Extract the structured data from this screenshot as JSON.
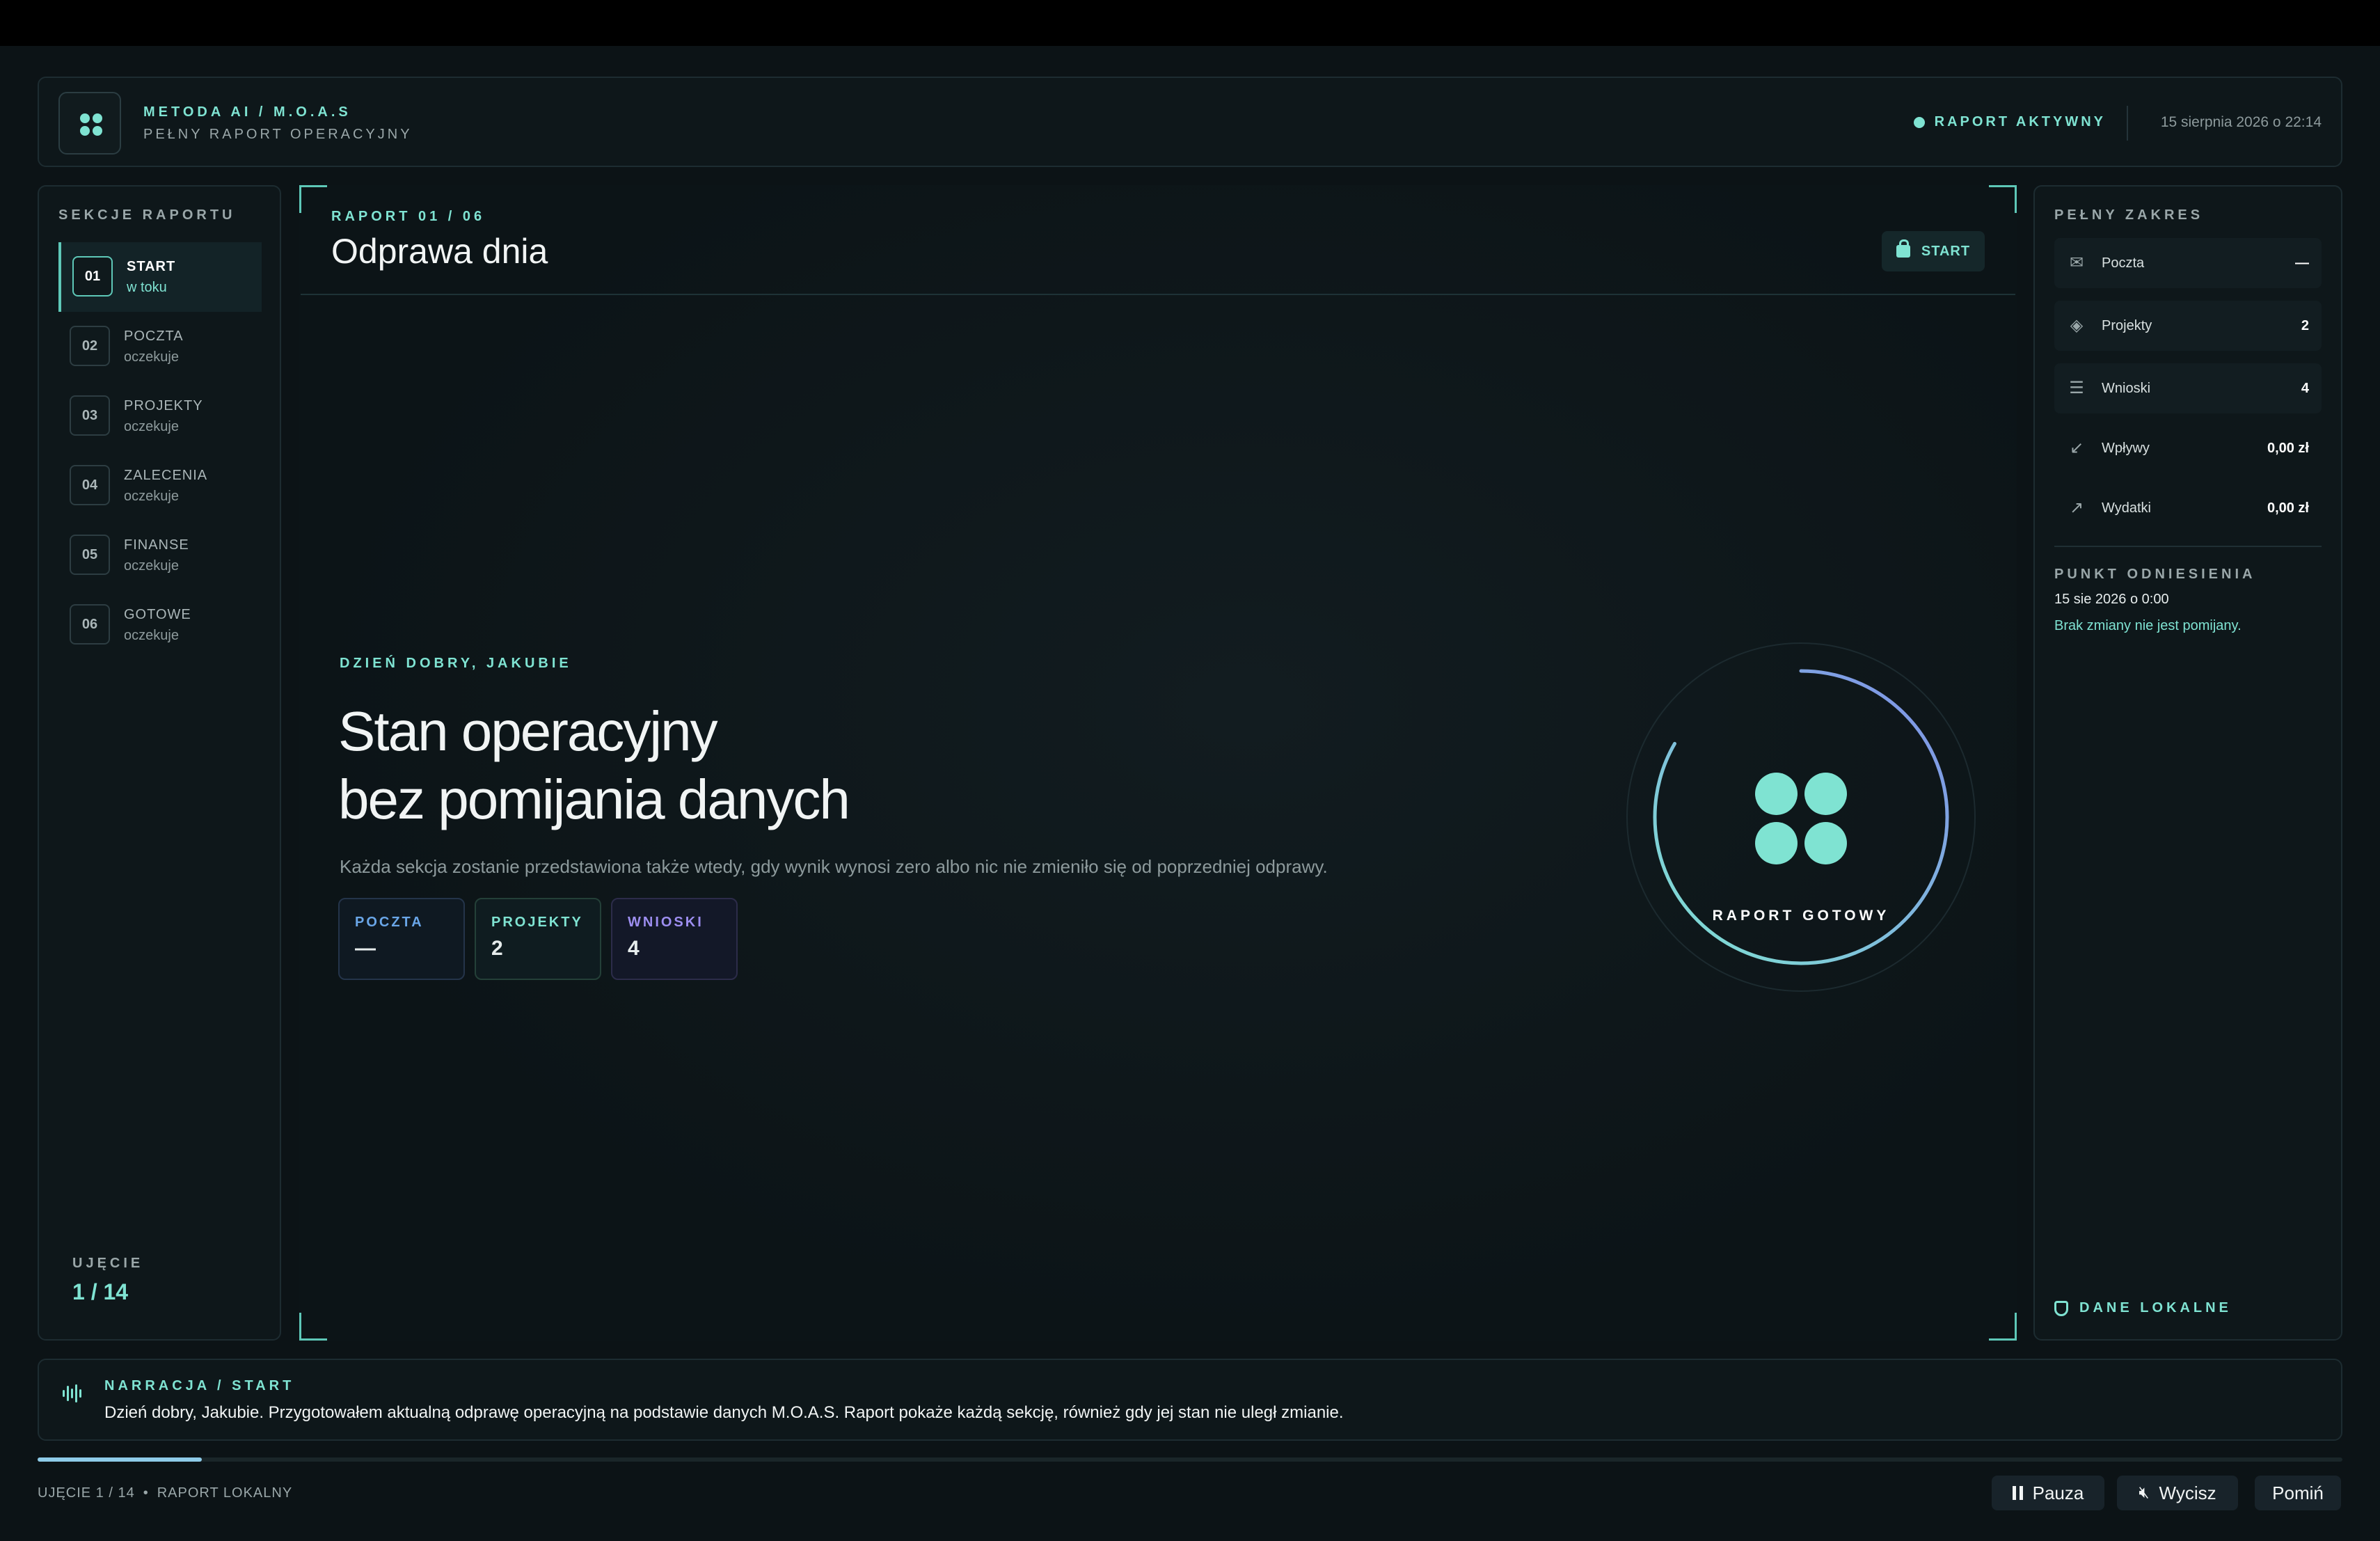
{
  "header": {
    "brand_title": "METODA AI / M.O.A.S",
    "brand_subtitle": "PEŁNY RAPORT OPERACYJNY",
    "status": "RAPORT AKTYWNY",
    "datetime": "15 sierpnia 2026 o 22:14"
  },
  "sidebar": {
    "label": "SEKCJE RAPORTU",
    "items": [
      {
        "num": "01",
        "name": "START",
        "state": "w toku",
        "active": true
      },
      {
        "num": "02",
        "name": "POCZTA",
        "state": "oczekuje"
      },
      {
        "num": "03",
        "name": "PROJEKTY",
        "state": "oczekuje"
      },
      {
        "num": "04",
        "name": "ZALECENIA",
        "state": "oczekuje"
      },
      {
        "num": "05",
        "name": "FINANSE",
        "state": "oczekuje"
      },
      {
        "num": "06",
        "name": "GOTOWE",
        "state": "oczekuje"
      }
    ],
    "shot_label": "UJĘCIE",
    "shot_value": "1 / 14"
  },
  "main": {
    "report_num": "RAPORT 01 / 06",
    "title": "Odprawa dnia",
    "chip_label": "START",
    "greeting": "DZIEŃ DOBRY, JAKUBIE",
    "headline_1": "Stan operacyjny",
    "headline_2": "bez pomijania danych",
    "subtext": "Każda sekcja zostanie przedstawiona także wtedy, gdy wynik wynosi zero albo nic nie zmieniło się od poprzedniej odprawy.",
    "cards": [
      {
        "label": "POCZTA",
        "value": "—"
      },
      {
        "label": "PROJEKTY",
        "value": "2"
      },
      {
        "label": "WNIOSKI",
        "value": "4"
      }
    ],
    "ring_label": "RAPORT GOTOWY"
  },
  "right_panel": {
    "label": "PEŁNY ZAKRES",
    "rows": [
      {
        "icon": "mail-icon",
        "name": "Poczta",
        "value": "—"
      },
      {
        "icon": "layers-icon",
        "name": "Projekty",
        "value": "2"
      },
      {
        "icon": "list-icon",
        "name": "Wnioski",
        "value": "4"
      },
      {
        "icon": "arrow-in-icon",
        "name": "Wpływy",
        "value": "0,00 zł"
      },
      {
        "icon": "arrow-out-icon",
        "name": "Wydatki",
        "value": "0,00 zł"
      }
    ],
    "ref_label": "PUNKT ODNIESIENIA",
    "ref_date": "15 sie 2026 o 0:00",
    "ref_note": "Brak zmiany nie jest pomijany.",
    "local_label": "DANE LOKALNE"
  },
  "narration": {
    "label": "NARRACJA / START",
    "text": "Dzień dobry, Jakubie. Przygotowałem aktualną odprawę operacyjną na podstawie danych M.O.A.S. Raport pokaże każdą sekcję, również gdy jej stan nie uległ zmianie."
  },
  "footer": {
    "progress_fraction": 0.0714,
    "shot": "UJĘCIE 1 / 14",
    "separator": "•",
    "mode": "RAPORT LOKALNY",
    "pause_label": "Pauza",
    "mute_label": "Wycisz",
    "skip_label": "Pomiń"
  },
  "colors": {
    "accent": "#7fe3d2",
    "background": "#0c1316",
    "blue": "#6aa6e8",
    "violet": "#9d8ef0"
  }
}
